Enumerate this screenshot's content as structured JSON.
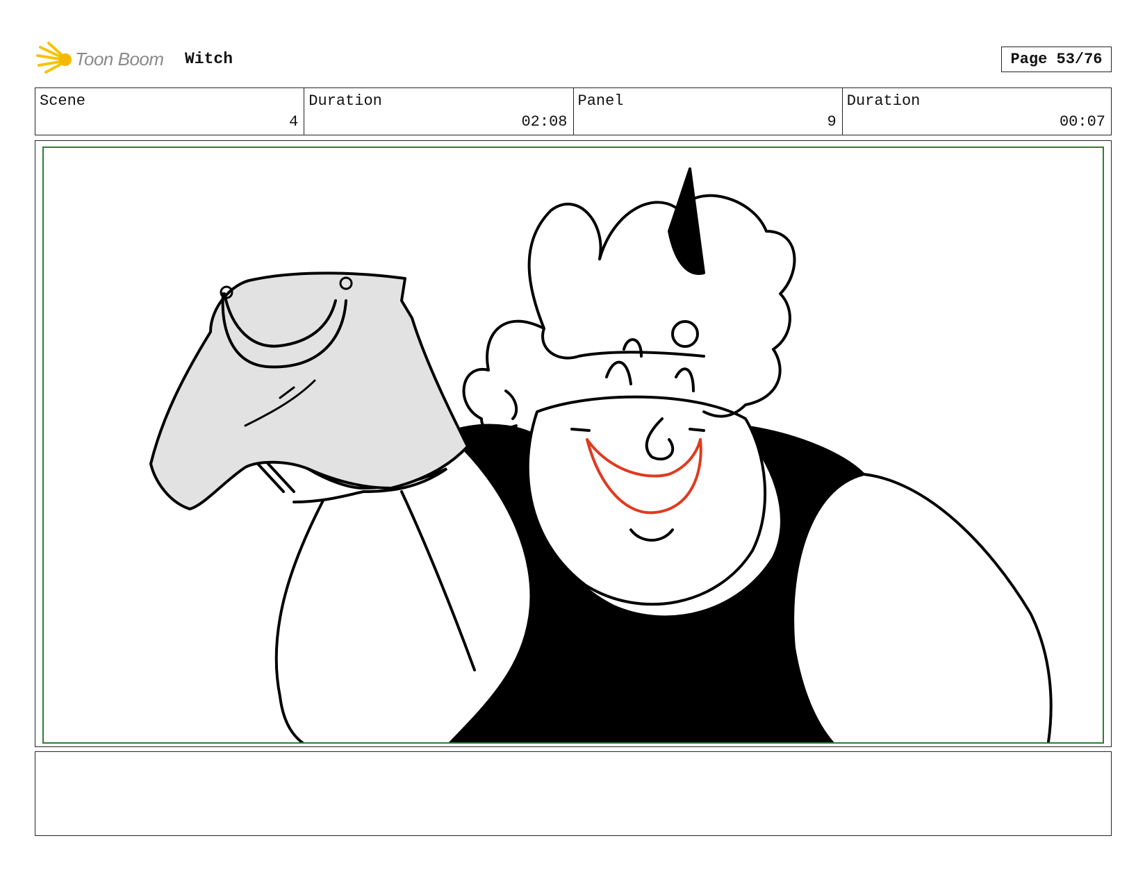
{
  "header": {
    "logo_text": "Toon Boom",
    "project_title": "Witch",
    "page_label": "Page 53/76"
  },
  "info": {
    "scene_label": "Scene",
    "scene_value": "4",
    "scene_duration_label": "Duration",
    "scene_duration_value": "02:08",
    "panel_label": "Panel",
    "panel_value": "9",
    "panel_duration_label": "Duration",
    "panel_duration_value": "00:07"
  },
  "panel": {
    "image_description_icon": "storyboard-sketch"
  },
  "notes": {
    "text": ""
  },
  "colors": {
    "safe_frame": "#2f7d2f",
    "mouth": "#e03a1e",
    "bag": "#e2e2e2",
    "logo_flare": "#f5c400"
  }
}
